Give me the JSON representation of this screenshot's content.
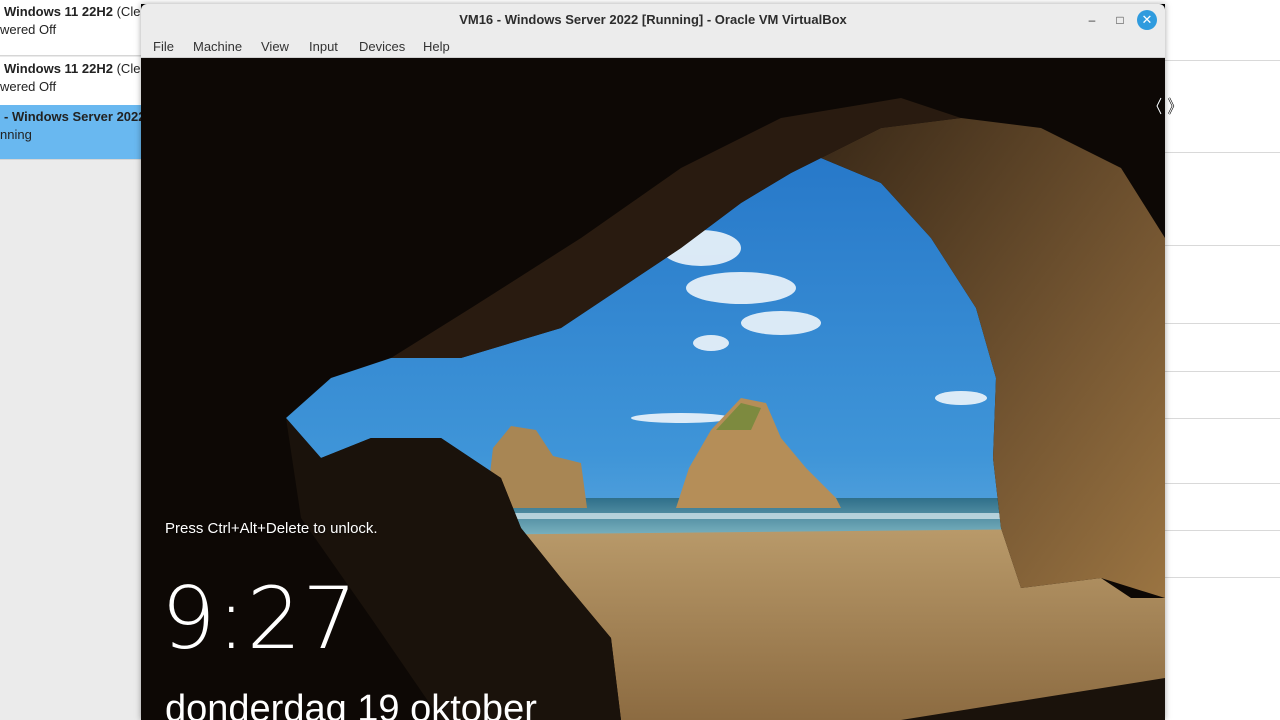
{
  "manager": {
    "vm_items": [
      {
        "name": "Windows 11 22H2",
        "name_suffix": " (Clea",
        "state": "wered Off"
      },
      {
        "name": "Windows 11 22H2",
        "name_suffix": " (Clea",
        "state": "wered Off"
      },
      {
        "name": "- Windows Server 2022",
        "name_suffix": "",
        "state": "nning"
      }
    ],
    "selected_color": "#69b8f0"
  },
  "vm_window": {
    "title": "VM16 - Windows Server 2022 [Running] - Oracle VM VirtualBox",
    "menu": [
      "File",
      "Machine",
      "View",
      "Input",
      "Devices",
      "Help"
    ],
    "buttons": {
      "minimize": "–",
      "maximize": "□",
      "close": "✕"
    },
    "accent": "#2f9bde"
  },
  "lock_screen": {
    "hint": "Press Ctrl+Alt+Delete to unlock.",
    "time": "9:27",
    "date": "donderdag 19 oktober"
  }
}
